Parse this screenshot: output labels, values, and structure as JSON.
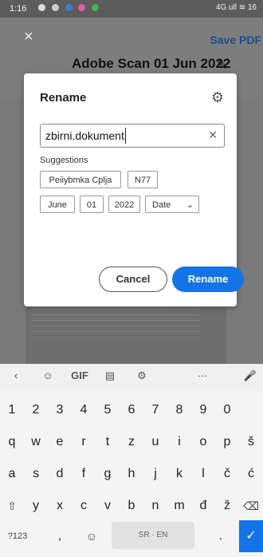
{
  "status": {
    "time": "1:16",
    "right": "4G ull ≋ 16"
  },
  "topbar": {
    "close": "×",
    "save_pdf": "Save PDF",
    "title": "Adobe Scan 01 Jun 2022"
  },
  "dialog": {
    "title": "Rename",
    "input_value": "zbirni.dokument",
    "suggestions_label": "Suggestions",
    "chips_row1": [
      "Peiiybmka Cplja",
      "N77"
    ],
    "chips_row2": [
      "June",
      "01",
      "2022"
    ],
    "date_select": "Date",
    "cancel": "Cancel",
    "rename": "Rename"
  },
  "keyboard": {
    "toolbar": [
      "‹",
      "☺",
      "GIF",
      "▤",
      "⚙",
      "···",
      "🎤"
    ],
    "row_numbers": [
      "1",
      "2",
      "3",
      "4",
      "5",
      "6",
      "7",
      "8",
      "9",
      "0"
    ],
    "row1": [
      "q",
      "w",
      "e",
      "r",
      "t",
      "z",
      "u",
      "i",
      "o",
      "p",
      "š"
    ],
    "row2": [
      "a",
      "s",
      "d",
      "f",
      "g",
      "h",
      "j",
      "k",
      "l",
      "č",
      "ć"
    ],
    "row3": [
      "y",
      "x",
      "c",
      "v",
      "b",
      "n",
      "m",
      "đ",
      "ž"
    ],
    "sym": "?123",
    "comma": ",",
    "space": "SR · EN",
    "period": "."
  }
}
